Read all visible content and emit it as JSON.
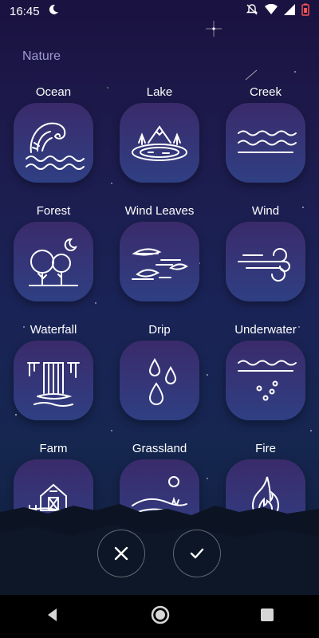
{
  "status_bar": {
    "time": "16:45"
  },
  "section_title": "Nature",
  "tiles": [
    {
      "label": "Ocean",
      "icon": "ocean-wave-icon"
    },
    {
      "label": "Lake",
      "icon": "lake-icon"
    },
    {
      "label": "Creek",
      "icon": "creek-icon"
    },
    {
      "label": "Forest",
      "icon": "forest-icon"
    },
    {
      "label": "Wind Leaves",
      "icon": "wind-leaves-icon"
    },
    {
      "label": "Wind",
      "icon": "wind-icon"
    },
    {
      "label": "Waterfall",
      "icon": "waterfall-icon"
    },
    {
      "label": "Drip",
      "icon": "drip-icon"
    },
    {
      "label": "Underwater",
      "icon": "underwater-icon"
    },
    {
      "label": "Farm",
      "icon": "farm-icon"
    },
    {
      "label": "Grassland",
      "icon": "grassland-icon"
    },
    {
      "label": "Fire",
      "icon": "fire-icon"
    }
  ],
  "actions": {
    "cancel_icon": "close-icon",
    "confirm_icon": "check-icon"
  },
  "nav": {
    "back_icon": "back-icon",
    "home_icon": "home-icon",
    "recents_icon": "recents-icon"
  }
}
